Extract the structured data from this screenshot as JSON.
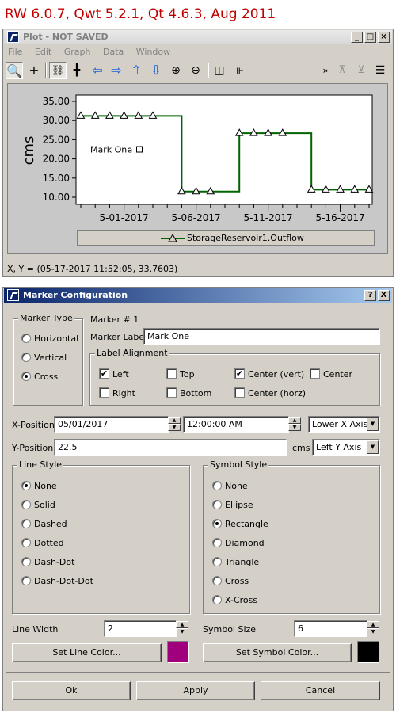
{
  "header_title": "RW 6.0.7, Qwt 5.2.1, Qt 4.6.3, Aug 2011",
  "plot_window": {
    "title": "Plot - NOT SAVED",
    "menu": [
      "File",
      "Edit",
      "Graph",
      "Data",
      "Window"
    ],
    "toolbar_icons": [
      "zoom-icon",
      "crosshair-icon",
      "link-icon",
      "axes-icon",
      "arrow-left-icon",
      "arrow-right-icon",
      "arrow-up-icon",
      "arrow-down-icon",
      "zoom-in-icon",
      "zoom-out-icon",
      "split-horizontal-icon",
      "split-vertical-icon",
      "more-icon",
      "align-top-icon",
      "align-bottom-icon",
      "list-icon"
    ],
    "status": "X, Y = (05-17-2017 11:52:05, 33.7603)"
  },
  "chart_data": {
    "type": "line",
    "ylabel": "cms",
    "xlabel": "",
    "ylim": [
      10.0,
      35.0
    ],
    "y_ticks": [
      "35.00",
      "30.00",
      "25.00",
      "20.00",
      "15.00",
      "10.00"
    ],
    "x_ticks": [
      "5-01-2017",
      "5-06-2017",
      "5-11-2017",
      "5-16-2017"
    ],
    "series": [
      {
        "name": "StorageReservoir1.Outflow",
        "color": "#006400",
        "symbol": "triangle",
        "x": [
          0,
          1,
          2,
          3,
          4,
          5,
          6,
          7,
          8,
          9,
          10,
          11,
          12,
          13,
          14,
          15,
          16,
          17,
          18,
          19,
          20
        ],
        "y": [
          31.2,
          31.2,
          31.2,
          31.2,
          31.2,
          31.2,
          31.2,
          11.5,
          11.5,
          11.5,
          11.5,
          26.7,
          26.7,
          26.7,
          26.7,
          26.7,
          12.0,
          12.0,
          12.0,
          12.0,
          12.0
        ]
      }
    ],
    "marker": {
      "label": "Mark One",
      "x": "05/01/2017 12:00:00 AM",
      "y": 22.5
    }
  },
  "dialog": {
    "title": "Marker Configuration",
    "help_btn": "?",
    "close_btn": "X",
    "marker_type_title": "Marker Type",
    "marker_types": [
      "Horizontal",
      "Vertical",
      "Cross"
    ],
    "marker_type_selected": "Cross",
    "marker_number": "Marker #  1",
    "marker_label_caption": "Marker Label",
    "marker_label_value": "Mark One",
    "label_alignment_title": "Label Alignment",
    "alignment": {
      "left": {
        "label": "Left",
        "checked": "✔"
      },
      "right": {
        "label": "Right",
        "checked": ""
      },
      "top": {
        "label": "Top",
        "checked": ""
      },
      "bottom": {
        "label": "Bottom",
        "checked": ""
      },
      "center_vert": {
        "label": "Center (vert)",
        "checked": "✔"
      },
      "center_horz": {
        "label": "Center (horz)",
        "checked": ""
      },
      "center": {
        "label": "Center",
        "checked": ""
      }
    },
    "x_position_caption": "X-Position",
    "x_date": "05/01/2017",
    "x_time": "12:00:00 AM",
    "x_axis": "Lower X Axis",
    "y_position_caption": "Y-Position",
    "y_value": "22.5",
    "y_unit": "cms",
    "y_axis": "Left Y Axis",
    "line_style_title": "Line Style",
    "line_styles": [
      "None",
      "Solid",
      "Dashed",
      "Dotted",
      "Dash-Dot",
      "Dash-Dot-Dot"
    ],
    "line_style_selected": "None",
    "symbol_style_title": "Symbol Style",
    "symbol_styles": [
      "None",
      "Ellipse",
      "Rectangle",
      "Diamond",
      "Triangle",
      "Cross",
      "X-Cross"
    ],
    "symbol_style_selected": "Rectangle",
    "line_width_caption": "Line Width",
    "line_width_value": "2",
    "symbol_size_caption": "Symbol Size",
    "symbol_size_value": "6",
    "set_line_color": "Set Line Color...",
    "set_symbol_color": "Set Symbol Color...",
    "line_color": "#a0007e",
    "symbol_color": "#000000",
    "ok": "Ok",
    "apply": "Apply",
    "cancel": "Cancel"
  }
}
